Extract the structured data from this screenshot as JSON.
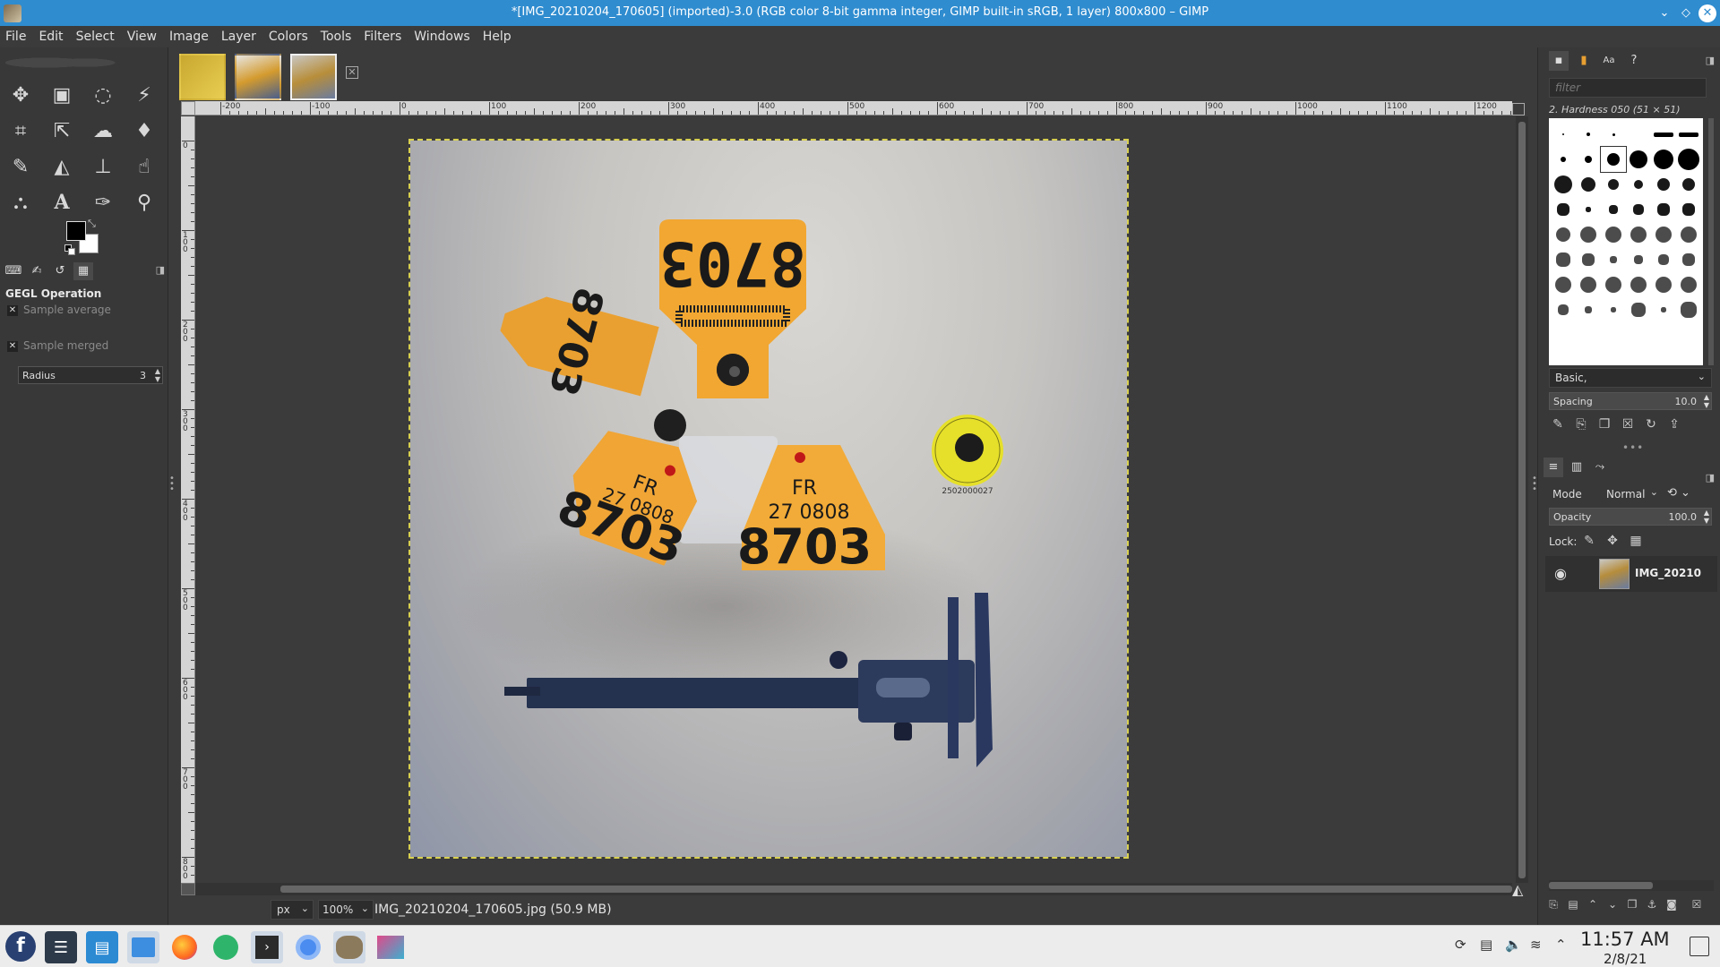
{
  "window": {
    "title": "*[IMG_20210204_170605] (imported)-3.0 (RGB color 8-bit gamma integer, GIMP built-in sRGB, 1 layer) 800x800 – GIMP",
    "controls": [
      "minimize-icon",
      "maximize-icon",
      "close-icon"
    ]
  },
  "menubar": {
    "items": [
      "File",
      "Edit",
      "Select",
      "View",
      "Image",
      "Layer",
      "Colors",
      "Tools",
      "Filters",
      "Windows",
      "Help"
    ]
  },
  "toolbox": {
    "tools": [
      "move-icon",
      "rect-select-icon",
      "lasso-icon",
      "fuzzy-select-icon",
      "crop-icon",
      "transform-icon",
      "warp-icon",
      "bucket-fill-icon",
      "paintbrush-icon",
      "eraser-icon",
      "clone-icon",
      "smudge-icon",
      "paths-icon",
      "text-icon",
      "color-picker-icon",
      "zoom-icon"
    ],
    "fg_color": "#000000",
    "bg_color": "#ffffff"
  },
  "tool_options": {
    "title": "GEGL Operation",
    "sample_average": "Sample average",
    "radius_label": "Radius",
    "radius_value": "3",
    "sample_merged": "Sample merged"
  },
  "canvas": {
    "image_tabs": [
      "yellow-tag-thumb",
      "tag-closeup-thumb",
      "caliper-tags-thumb"
    ],
    "active_tab": 2,
    "ruler_h_labels": [
      "-200",
      "-100",
      "0",
      "100",
      "200",
      "300",
      "400",
      "500",
      "600",
      "700",
      "800",
      "900",
      "1000",
      "1100",
      "1200"
    ],
    "ruler_v_labels": [
      "0",
      "1 0 0",
      "2 0 0",
      "3 0 0",
      "4 0 0",
      "5 0 0",
      "6 0 0",
      "7 0 0",
      "8 0 0"
    ],
    "tag_number": "8703",
    "tag_country": "FR",
    "tag_code": "27 0808",
    "round_tag_code": "2502000027",
    "selection_color": "#d8d050"
  },
  "statusbar": {
    "unit": "px",
    "zoom": "100%",
    "file_info": "IMG_20210204_170605.jpg (50.9 MB)"
  },
  "brushes": {
    "filter_placeholder": "filter",
    "selected_name": "2. Hardness 050 (51 × 51)",
    "preset": "Basic,",
    "spacing_label": "Spacing",
    "spacing_value": "10.0"
  },
  "layers": {
    "mode_label": "Mode",
    "mode_value": "Normal",
    "opacity_label": "Opacity",
    "opacity_value": "100.0",
    "lock_label": "Lock:",
    "layer_name": "IMG_20210"
  },
  "taskbar": {
    "time": "11:57 AM",
    "date": "2/8/21",
    "accent": "#2f8ccf"
  }
}
